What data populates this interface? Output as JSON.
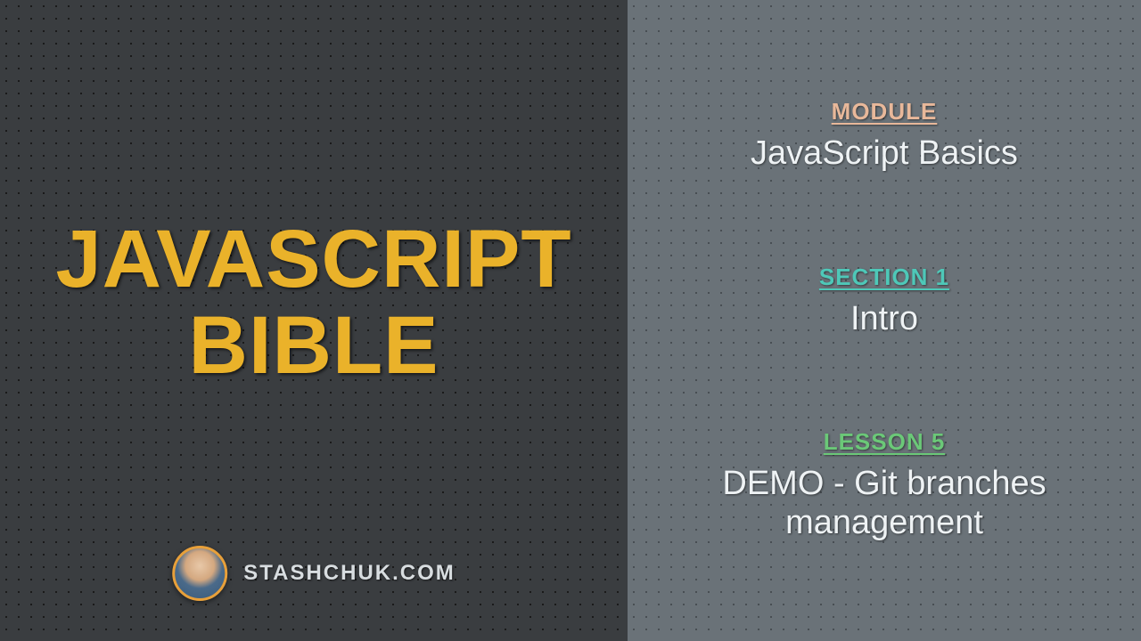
{
  "title": {
    "line1": "JAVASCRIPT",
    "line2": "BIBLE"
  },
  "footer": {
    "site": "STASHCHUK.COM"
  },
  "module": {
    "label": "MODULE",
    "value": "JavaScript Basics"
  },
  "section": {
    "label": "SECTION 1",
    "value": "Intro"
  },
  "lesson": {
    "label": "LESSON 5",
    "value": "DEMO - Git branches management"
  }
}
